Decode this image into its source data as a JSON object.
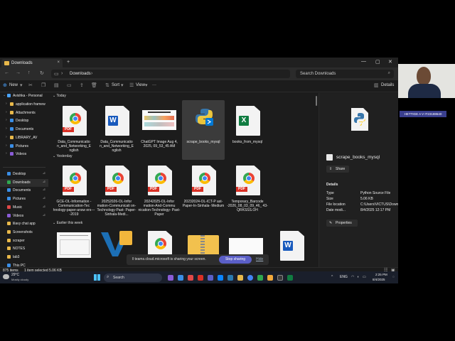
{
  "window": {
    "tab_title": "Downloads",
    "new_tab": "+",
    "tab_close": "×",
    "controls": [
      "—",
      "▢",
      "✕"
    ]
  },
  "address": {
    "crumb_separator": "›",
    "current_folder": "Downloads",
    "search_placeholder": "Search Downloads"
  },
  "commands": {
    "new": "New",
    "sort": "Sort",
    "view": "View",
    "more": "···",
    "details": "Details"
  },
  "sidebar": {
    "root": "Avishka - Personal",
    "tree": [
      {
        "label": "application framew",
        "color": "#e8b84a"
      },
      {
        "label": "Attachments",
        "color": "#e8b84a"
      },
      {
        "label": "Desktop",
        "color": "#3a8ee6"
      },
      {
        "label": "Documents",
        "color": "#3a8ee6"
      },
      {
        "label": "LIBRARY_AV",
        "color": "#e8b84a"
      },
      {
        "label": "Pictures",
        "color": "#3a8ee6"
      },
      {
        "label": "Videos",
        "color": "#8a5cd6"
      }
    ],
    "quick": [
      {
        "label": "Desktop",
        "color": "#3a8ee6"
      },
      {
        "label": "Downloads",
        "color": "#2fa84f"
      },
      {
        "label": "Documents",
        "color": "#3a8ee6"
      },
      {
        "label": "Pictures",
        "color": "#3a8ee6"
      },
      {
        "label": "Music",
        "color": "#e04848"
      },
      {
        "label": "Videos",
        "color": "#8a5cd6"
      },
      {
        "label": "lilavy chat app",
        "color": "#e8b84a"
      },
      {
        "label": "Screenshots",
        "color": "#e8b84a"
      },
      {
        "label": "scraper",
        "color": "#e8b84a"
      },
      {
        "label": "NOTES",
        "color": "#e8b84a"
      },
      {
        "label": "lab3",
        "color": "#e8b84a"
      },
      {
        "label": "This PC",
        "color": "#3a8ee6"
      }
    ]
  },
  "groups": {
    "today": "Today",
    "yesterday": "Yesterday",
    "earlier": "Earlier this week"
  },
  "files_today": [
    {
      "name": "Data_Communicatio n_and_Networking_E nglish",
      "kind": "pdf"
    },
    {
      "name": "Data_Communicatio n_and_Networking_E nglish",
      "kind": "word"
    },
    {
      "name": "ChatGPT Image Aug 4, 2025, 09_53_45 AM",
      "kind": "image"
    },
    {
      "name": "scrape_books_mysql",
      "kind": "python"
    },
    {
      "name": "books_from_mysql",
      "kind": "excel"
    }
  ],
  "files_yesterday": [
    {
      "name": "GCE-OL-Information -Communication-Tec hnology-paper-answ ers----2019",
      "kind": "pdf"
    },
    {
      "name": "20252026-OL-Infor mation-Communicati on-Technology-Past- Paper-Sinhala-Medi...",
      "kind": "pdf"
    },
    {
      "name": "20242025-OL-Infor mation-And-Commu nication-Technology- Past-Paper",
      "kind": "pdf"
    },
    {
      "name": "20232024-OL-ICT-P ast-Paper-In-Sinhala- Medium",
      "kind": "pdf"
    },
    {
      "name": "Temporary_Barcode -2026_08_03_09_46_ 43-QRKSSS.OH",
      "kind": "pdf"
    }
  ],
  "details_pane": {
    "file_name": "scrape_books_mysql",
    "share": "Share",
    "heading": "Details",
    "rows": [
      {
        "key": "Type",
        "value": "Python Source File"
      },
      {
        "key": "Size",
        "value": "5.06 KB"
      },
      {
        "key": "File location",
        "value": "C:\\Users\\VICTUS\\Down..."
      },
      {
        "key": "Date modi...",
        "value": "8/4/2025 12:17 PM"
      }
    ],
    "properties": "Properties"
  },
  "status": {
    "items": "875 items",
    "selected": "1 item selected  5.06 KB"
  },
  "sharing": {
    "message": "teams.cloud.microsoft is sharing your screen.",
    "stop": "Stop sharing",
    "hide": "Hide"
  },
  "taskbar": {
    "weather_temp": "29°C",
    "weather_desc": "Mostly cloudy",
    "search": "Search",
    "lang": "ENG",
    "time": "2:25 PM",
    "date": "8/4/2025"
  },
  "webcam": {
    "name_tag": "HETTIGE A V IT23188640"
  },
  "colors": {
    "accent": "#5b5fc7",
    "pdf_red": "#d93025",
    "word_blue": "#185abd",
    "excel_green": "#107c41",
    "folder_yellow": "#e8b84a"
  }
}
